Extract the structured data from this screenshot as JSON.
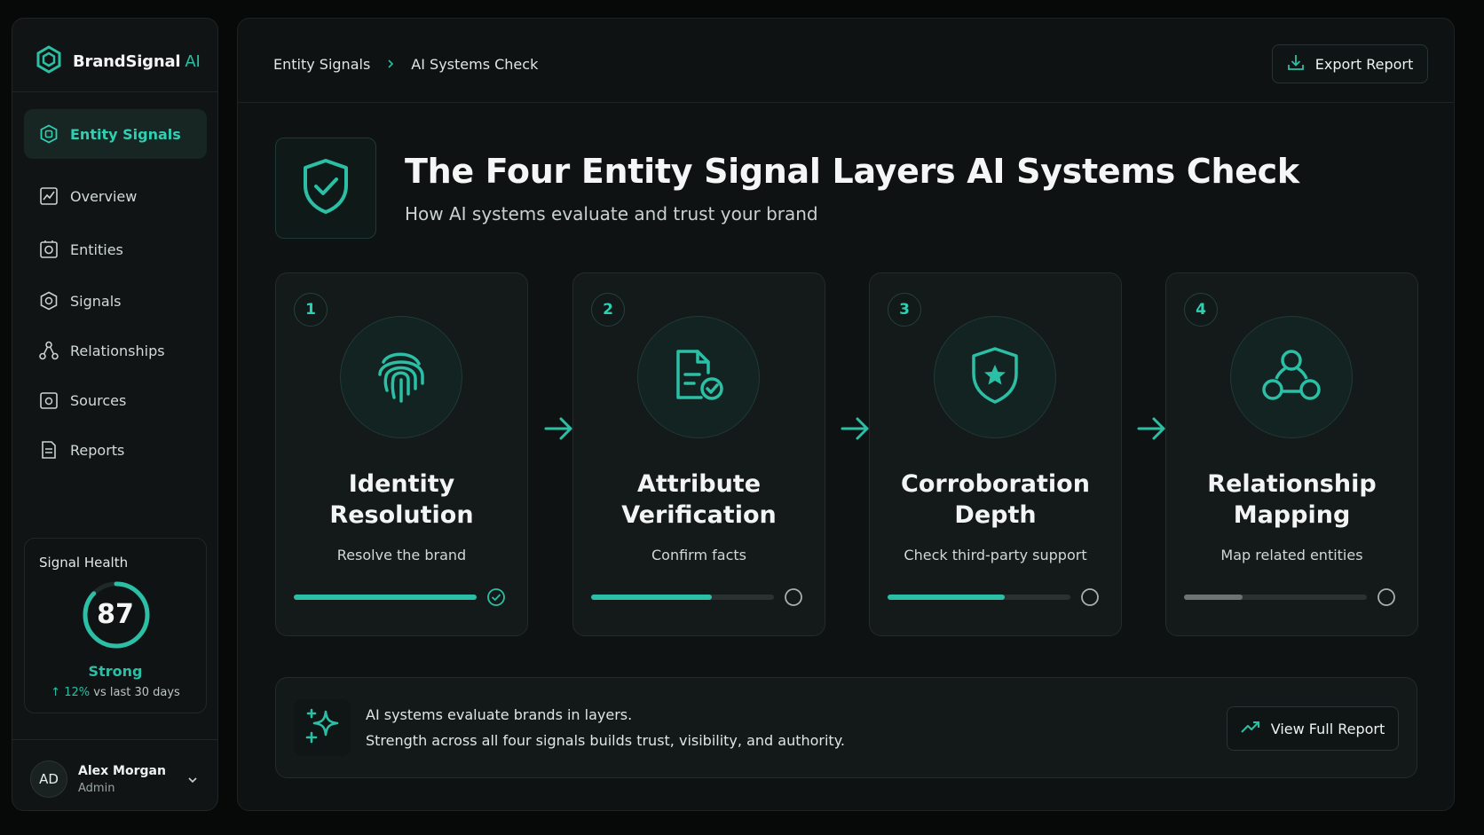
{
  "brand": {
    "name": "BrandSignal",
    "suffix": "AI"
  },
  "sidebar": {
    "active": {
      "label": "Entity Signals",
      "icon": "entity-icon"
    },
    "items": [
      {
        "label": "Overview",
        "icon": "chart-icon"
      },
      {
        "label": "Entities",
        "icon": "entities-icon"
      },
      {
        "label": "Signals",
        "icon": "signals-icon"
      },
      {
        "label": "Relationships",
        "icon": "network-icon"
      },
      {
        "label": "Sources",
        "icon": "sources-icon"
      },
      {
        "label": "Reports",
        "icon": "document-icon"
      }
    ]
  },
  "health": {
    "title": "Signal Health",
    "score": "87",
    "score_fraction": 0.87,
    "status": "Strong",
    "delta": "12%",
    "delta_text": "vs last 30 days"
  },
  "user": {
    "initials": "AD",
    "name": "Alex Morgan",
    "role": "Admin"
  },
  "breadcrumb": {
    "root": "Entity Signals",
    "current": "AI Systems Check"
  },
  "export_label": "Export Report",
  "hero": {
    "title": "The Four Entity Signal Layers AI Systems Check",
    "subtitle": "How AI systems evaluate and trust your brand"
  },
  "cards": [
    {
      "num": "1",
      "line1": "Identity",
      "line2": "Resolution",
      "desc": "Resolve the brand",
      "progress": 1.0,
      "complete": true,
      "icon": "fingerprint-icon"
    },
    {
      "num": "2",
      "line1": "Attribute",
      "line2": "Verification",
      "desc": "Confirm facts",
      "progress": 0.66,
      "complete": false,
      "icon": "verified-document-icon"
    },
    {
      "num": "3",
      "line1": "Corroboration",
      "line2": "Depth",
      "desc": "Check third-party support",
      "progress": 0.64,
      "complete": false,
      "icon": "shield-star-icon"
    },
    {
      "num": "4",
      "line1": "Relationship",
      "line2": "Mapping",
      "desc": "Map related entities",
      "progress": 0.32,
      "complete": false,
      "icon": "network-icon"
    }
  ],
  "insight": {
    "line1": "AI systems evaluate brands in layers.",
    "line2": "Strength across all four signals builds trust, visibility, and authority."
  },
  "report_label": "View Full Report",
  "colors": {
    "accent": "#2bbfa5",
    "background": "#070909",
    "panel": "#0e1212"
  }
}
